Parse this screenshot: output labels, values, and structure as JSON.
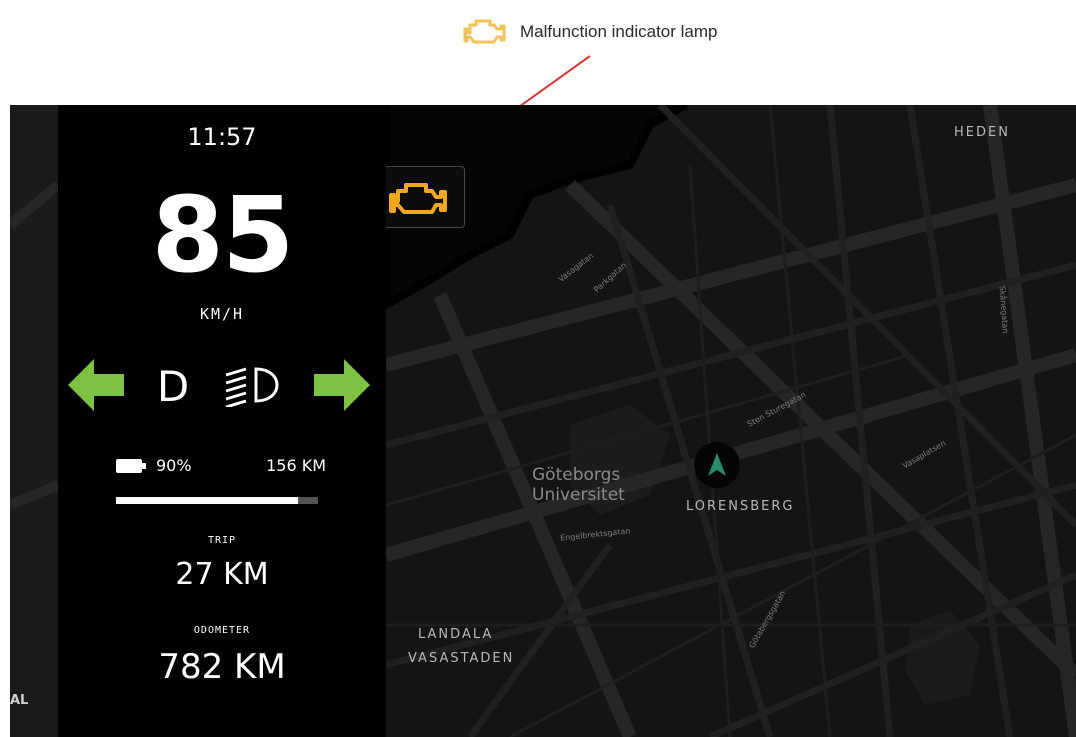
{
  "annotation": {
    "label": "Malfunction indicator lamp",
    "icon": "engine-icon",
    "arrow_color": "#d43a3a"
  },
  "dashboard": {
    "time": "11:57",
    "speed": "85",
    "speed_unit": "KM/H",
    "gear": "D",
    "left_turn_icon": "arrow-left-icon",
    "right_turn_icon": "arrow-right-icon",
    "headlight_icon": "low-beam-headlight-icon",
    "battery_icon": "battery-icon",
    "battery_percent": "90%",
    "battery_level": 0.9,
    "range": "156 KM",
    "trip_label": "TRIP",
    "trip_value": "27 KM",
    "odometer_label": "ODOMETER",
    "odometer_value": "782 KM"
  },
  "warning": {
    "icon": "check-engine-icon",
    "color": "#f0a81f"
  },
  "map": {
    "labels": {
      "heden": "HEDEN",
      "university": "Göteborgs Universitet",
      "lorensberg": "LORENSBERG",
      "landala": "LANDALA",
      "vasastaden": "VASASTADEN",
      "al": "AL"
    },
    "streets": [
      "Vasagatan",
      "Parkgatan",
      "Engelbrektsgatan",
      "Sten Sturegatan",
      "Skånegatan",
      "Vasaplatsen",
      "Götabergsgatan"
    ],
    "position_icon": "navigation-arrow-icon"
  },
  "colors": {
    "turn_signal": "#7dc242",
    "warning": "#f0a81f",
    "panel_bg": "#000000",
    "map_bg": "#141416",
    "nav_arrow": "#2a8a6a"
  }
}
